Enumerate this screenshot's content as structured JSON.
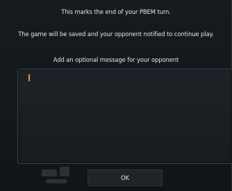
{
  "dialog": {
    "line1": "This marks the end of your PBEM turn.",
    "line2": "The game will be saved and your opponent notified to continue play.",
    "line3": "Add an optional message for your opponent",
    "message_value": "",
    "ok_label": "OK"
  },
  "colors": {
    "caret": "#e0a020",
    "text": "#e4e6e7",
    "panel": "#171b1f",
    "input_bg": "#1d2328"
  }
}
